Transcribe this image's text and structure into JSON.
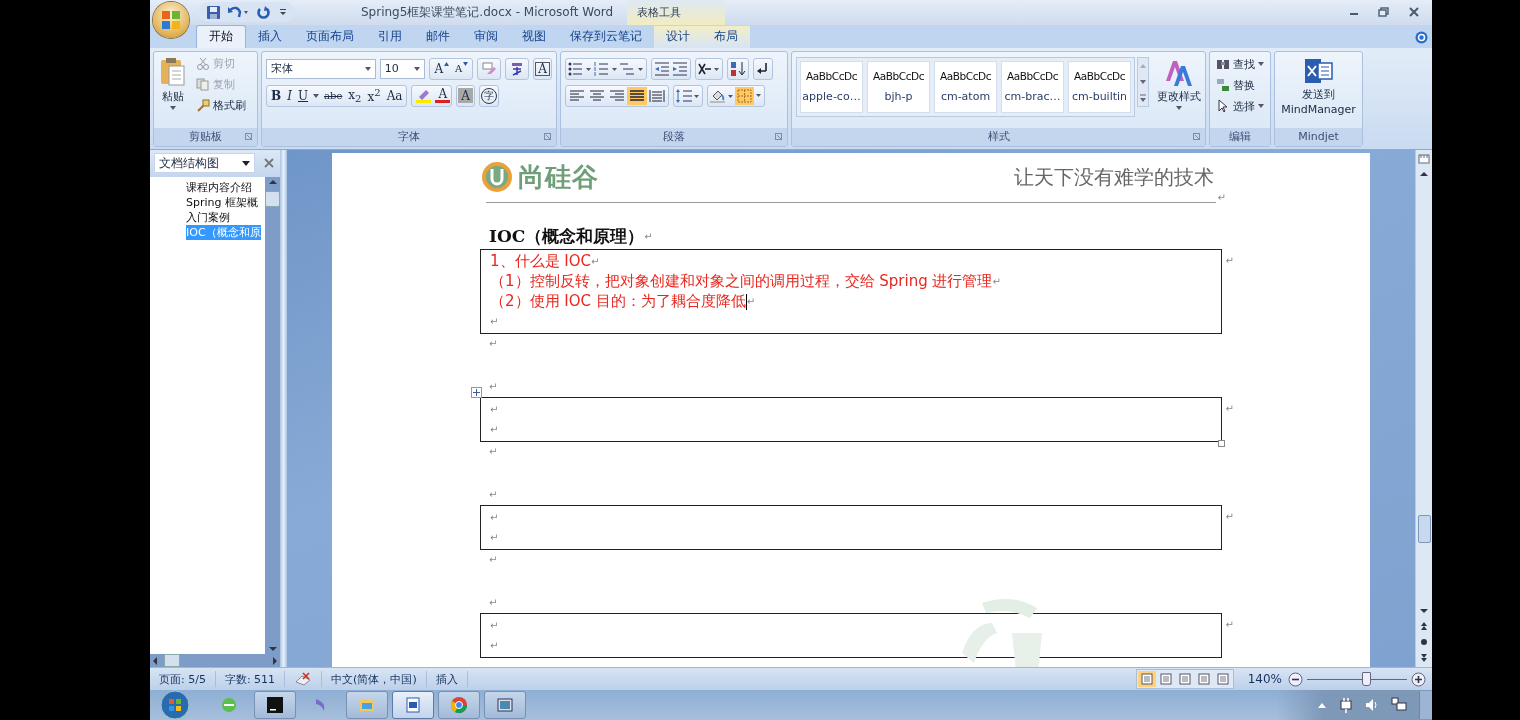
{
  "window": {
    "title": "Spring5框架课堂笔记.docx - Microsoft Word",
    "context_label": "表格工具"
  },
  "tabs": [
    {
      "label": "开始",
      "selected": true,
      "contextual": false
    },
    {
      "label": "插入",
      "selected": false,
      "contextual": false
    },
    {
      "label": "页面布局",
      "selected": false,
      "contextual": false
    },
    {
      "label": "引用",
      "selected": false,
      "contextual": false
    },
    {
      "label": "邮件",
      "selected": false,
      "contextual": false
    },
    {
      "label": "审阅",
      "selected": false,
      "contextual": false
    },
    {
      "label": "视图",
      "selected": false,
      "contextual": false
    },
    {
      "label": "保存到云笔记",
      "selected": false,
      "contextual": false
    },
    {
      "label": "设计",
      "selected": false,
      "contextual": true
    },
    {
      "label": "布局",
      "selected": false,
      "contextual": true
    }
  ],
  "clipboard": {
    "paste": "粘贴",
    "group": "剪贴板",
    "tools": [
      {
        "label": "剪切",
        "disabled": true
      },
      {
        "label": "复制",
        "disabled": true
      },
      {
        "label": "格式刷",
        "disabled": false
      }
    ]
  },
  "font": {
    "name": "宋体",
    "size": "10",
    "grow": "A",
    "shrink": "A",
    "border_char": "A",
    "bold": "B",
    "italic": "I",
    "underline": "U",
    "strike": "abe",
    "subscript": "x$_{2}$",
    "superscript": "x$^{2}$",
    "change_case": "Aa",
    "font_color": "A",
    "shading": "A",
    "enclose": "字",
    "group": "字体"
  },
  "paragraph": {
    "group": "段落",
    "alignments": [
      {
        "selected": false
      },
      {
        "selected": false
      },
      {
        "selected": false
      },
      {
        "selected": true
      },
      {
        "selected": false
      }
    ],
    "borders_on": true
  },
  "styles": {
    "group": "样式",
    "change": "更改样式",
    "items": [
      {
        "preview": "AaBbCcDc",
        "name": "apple-co…"
      },
      {
        "preview": "AaBbCcDc",
        "name": "bjh-p"
      },
      {
        "preview": "AaBbCcDc",
        "name": "cm-atom"
      },
      {
        "preview": "AaBbCcDc",
        "name": "cm-brac…"
      },
      {
        "preview": "AaBbCcDc",
        "name": "cm-builtin"
      }
    ]
  },
  "editing": {
    "group": "编辑",
    "tools": [
      "查找",
      "替换",
      "选择"
    ]
  },
  "mindjet": {
    "group": "Mindjet",
    "label_lines": [
      "发送到",
      "MindManager"
    ]
  },
  "nav": {
    "title": "文档结构图",
    "items": [
      {
        "label": "课程内容介绍",
        "selected": false
      },
      {
        "label": "Spring 框架概",
        "selected": false
      },
      {
        "label": "入门案例",
        "selected": false
      },
      {
        "label": "IOC（概念和原",
        "selected": true
      }
    ]
  },
  "document": {
    "logo": "尚硅谷",
    "slogan": "让天下没有难学的技术",
    "header_mark": "↵",
    "heading": "IOC（概念和原理）",
    "heading_mark": "↵",
    "blocks": [
      {
        "kind": "table",
        "hovered": false,
        "row_mark": "↵",
        "lines": [
          {
            "text": "1、什么是 IOC",
            "mark": "↵",
            "cursor": false
          },
          {
            "text": "（1）控制反转，把对象创建和对象之间的调用过程，交给 Spring 进行管理",
            "mark": "↵",
            "cursor": false
          },
          {
            "text": "（2）使用 IOC 目的：为了耦合度降低",
            "mark": "↵",
            "cursor": true
          },
          {
            "mark": "↵",
            "cursor": false
          }
        ]
      },
      {
        "kind": "empty",
        "mark": "↵"
      },
      {
        "kind": "empty",
        "mark": "↵"
      },
      {
        "kind": "table",
        "hovered": true,
        "row_mark": "↵",
        "lines": [
          {
            "mark": "↵",
            "cursor": false
          },
          {
            "mark": "↵",
            "cursor": false
          }
        ]
      },
      {
        "kind": "empty",
        "mark": "↵"
      },
      {
        "kind": "empty",
        "mark": "↵"
      },
      {
        "kind": "table",
        "hovered": false,
        "row_mark": "↵",
        "lines": [
          {
            "mark": "↵",
            "cursor": false
          },
          {
            "mark": "↵",
            "cursor": false
          }
        ]
      },
      {
        "kind": "empty",
        "mark": "↵"
      },
      {
        "kind": "empty",
        "mark": "↵"
      },
      {
        "kind": "table",
        "hovered": false,
        "row_mark": "↵",
        "lines": [
          {
            "mark": "↵",
            "cursor": false
          },
          {
            "mark": "↵",
            "cursor": false
          }
        ]
      }
    ]
  },
  "status": {
    "page": "页面: 5/5",
    "words": "字数: 511",
    "language": "中文(简体，中国)",
    "mode": "插入",
    "views": [
      {
        "selected": true
      },
      {
        "selected": false
      },
      {
        "selected": false
      },
      {
        "selected": false
      },
      {
        "selected": false
      }
    ],
    "zoom": "140%",
    "zoom_slider": {
      "level": 0.58
    }
  },
  "taskbar": {
    "apps": [
      {
        "running": false,
        "selected": false
      },
      {
        "running": true,
        "selected": false
      },
      {
        "running": false,
        "selected": false
      },
      {
        "running": true,
        "selected": false
      },
      {
        "running": true,
        "selected": true
      },
      {
        "running": true,
        "selected": false
      },
      {
        "running": true,
        "selected": false
      }
    ]
  }
}
